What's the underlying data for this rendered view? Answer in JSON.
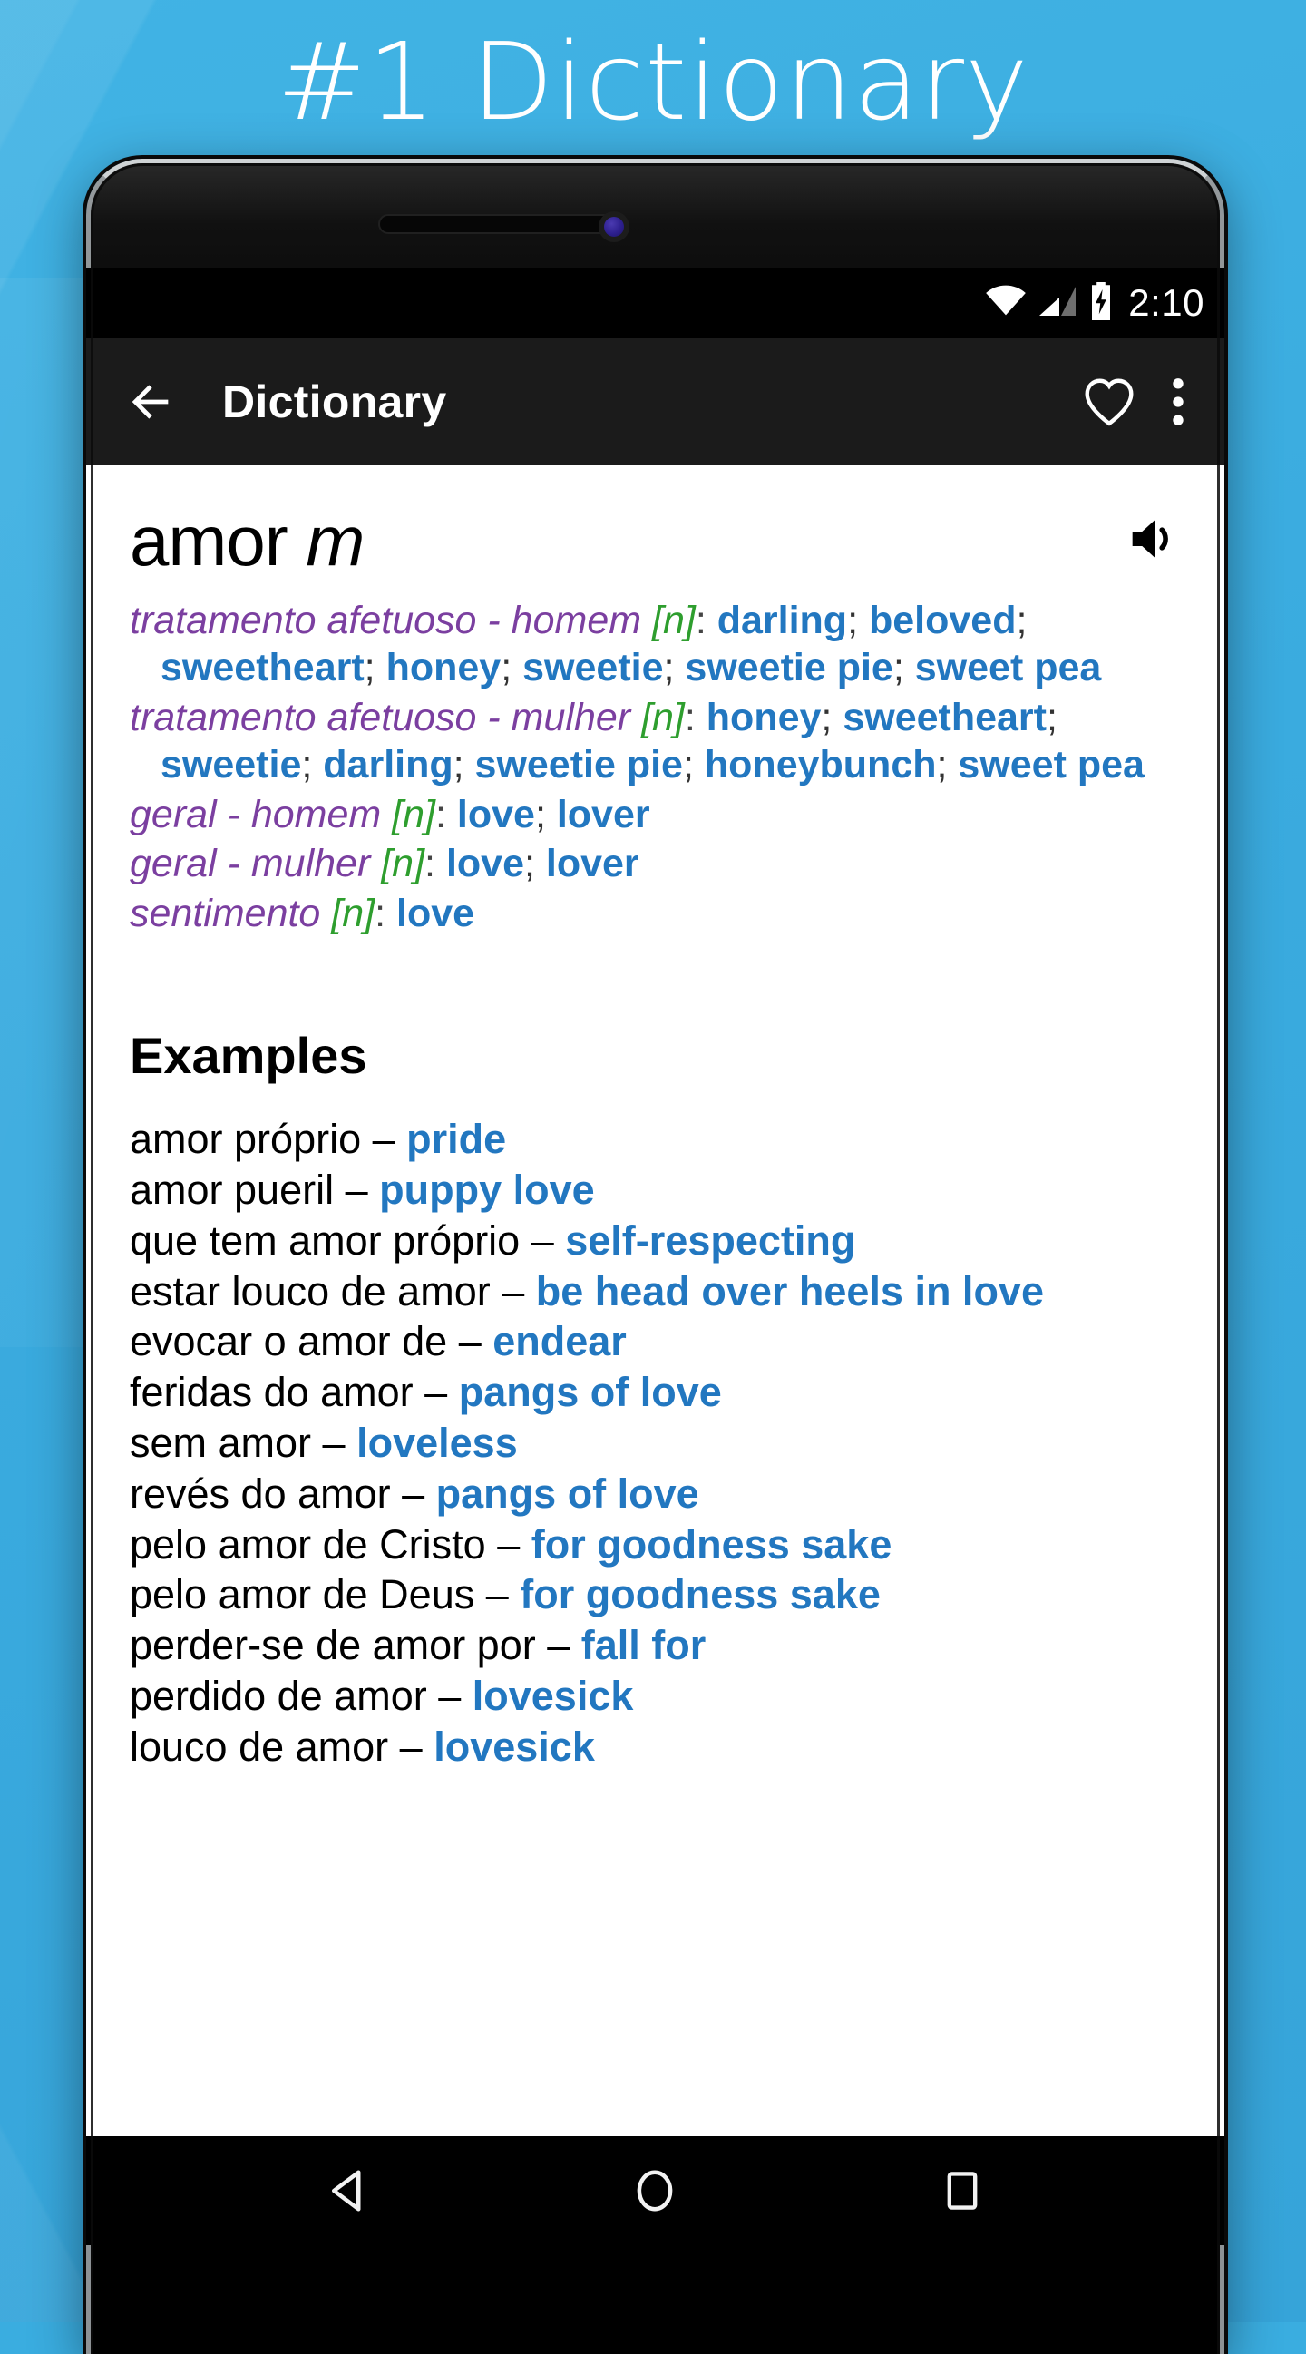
{
  "promo": {
    "headline": "#1 Dictionary",
    "background_color": "#3aade0"
  },
  "status_bar": {
    "time": "2:10",
    "icons": [
      "wifi-icon",
      "cellular-signal-icon",
      "battery-charging-icon"
    ]
  },
  "app_bar": {
    "back_icon": "back-arrow-icon",
    "title": "Dictionary",
    "favorite_icon": "heart-outline-icon",
    "overflow_icon": "overflow-menu-icon"
  },
  "entry": {
    "headword": "amor",
    "gender": "m",
    "speak_icon": "speaker-icon",
    "senses": [
      {
        "context": "tratamento afetuoso - homem",
        "pos": "[n]",
        "translations": [
          "darling",
          "beloved",
          "sweetheart",
          "honey",
          "sweetie",
          "sweetie pie",
          "sweet pea"
        ]
      },
      {
        "context": "tratamento afetuoso - mulher",
        "pos": "[n]",
        "translations": [
          "honey",
          "sweetheart",
          "sweetie",
          "darling",
          "sweetie pie",
          "honeybunch",
          "sweet pea"
        ]
      },
      {
        "context": "geral - homem",
        "pos": "[n]",
        "translations": [
          "love",
          "lover"
        ]
      },
      {
        "context": "geral - mulher",
        "pos": "[n]",
        "translations": [
          "love",
          "lover"
        ]
      },
      {
        "context": "sentimento",
        "pos": "[n]",
        "translations": [
          "love"
        ]
      }
    ]
  },
  "examples_section": {
    "title": "Examples",
    "dash": "–",
    "items": [
      {
        "pt": "amor próprio",
        "en": "pride"
      },
      {
        "pt": "amor pueril",
        "en": "puppy love"
      },
      {
        "pt": "que tem amor próprio",
        "en": "self-respecting"
      },
      {
        "pt": "estar louco de amor",
        "en": "be head over heels in love"
      },
      {
        "pt": "evocar o amor de",
        "en": "endear"
      },
      {
        "pt": "feridas do amor",
        "en": "pangs of love"
      },
      {
        "pt": "sem amor",
        "en": "loveless"
      },
      {
        "pt": "revés do amor",
        "en": "pangs of love"
      },
      {
        "pt": "pelo amor de Cristo",
        "en": "for goodness sake"
      },
      {
        "pt": "pelo amor de Deus",
        "en": "for goodness sake"
      },
      {
        "pt": "perder-se de amor por",
        "en": "fall for"
      },
      {
        "pt": "perdido de amor",
        "en": "lovesick"
      },
      {
        "pt": "louco de amor",
        "en": "lovesick"
      }
    ]
  },
  "nav_bar": {
    "back": "nav-back-icon",
    "home": "nav-home-icon",
    "recents": "nav-recents-icon"
  },
  "colors": {
    "context_purple": "#7b3fa0",
    "pos_green": "#2e9e2e",
    "translation_blue": "#2277c0",
    "app_bar": "#1b1b1b",
    "promo_blue": "#3aade0"
  },
  "hardware": {
    "earpiece": "earpiece-speaker",
    "camera": "front-camera",
    "volume_button": "volume-button",
    "power_button": "power-button"
  }
}
